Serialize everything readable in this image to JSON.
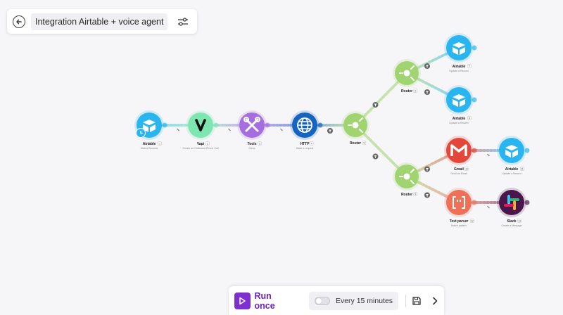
{
  "header": {
    "scenario_name": "Integration Airtable + voice agent"
  },
  "toolbar": {
    "run_once_label": "Run once",
    "schedule_label": "Every 15 minutes",
    "schedule_enabled": false
  },
  "colors": {
    "airtable": "#29b6f0",
    "vapi": "#7ee6b0",
    "tools": "#a56ee0",
    "http": "#1565c0",
    "router": "#9fd470",
    "gmail": "#e2473a",
    "text_parser": "#f07057",
    "slack": "#4a154b",
    "accent": "#7f2fd0"
  },
  "modules": [
    {
      "id": "m1",
      "name": "Airtable",
      "sub": "Watch Records",
      "kind": "airtable",
      "badge": "1"
    },
    {
      "id": "m2",
      "name": "Vapi",
      "sub": "Create an Outbound Phone Call",
      "kind": "vapi",
      "badge": "2"
    },
    {
      "id": "m3",
      "name": "Tools",
      "sub": "Sleep",
      "kind": "tools",
      "badge": "3"
    },
    {
      "id": "m4",
      "name": "HTTP",
      "sub": "Make a request",
      "kind": "http",
      "badge": "4"
    },
    {
      "id": "m5",
      "name": "Router",
      "sub": "",
      "kind": "router",
      "badge": "5"
    },
    {
      "id": "m6",
      "name": "Router",
      "sub": "",
      "kind": "router",
      "badge": "6"
    },
    {
      "id": "m7",
      "name": "Airtable",
      "sub": "Update a Record",
      "kind": "airtable",
      "badge": "7"
    },
    {
      "id": "m8",
      "name": "Airtable",
      "sub": "Update a Record",
      "kind": "airtable",
      "badge": "8"
    },
    {
      "id": "m9",
      "name": "Router",
      "sub": "",
      "kind": "router",
      "badge": "9"
    },
    {
      "id": "m10",
      "name": "Gmail",
      "sub": "Send an Email",
      "kind": "gmail",
      "badge": "10"
    },
    {
      "id": "m11",
      "name": "Airtable",
      "sub": "Update a Record",
      "kind": "airtable",
      "badge": "11"
    },
    {
      "id": "m12",
      "name": "Text parser",
      "sub": "Match pattern",
      "kind": "text_parser",
      "badge": "12"
    },
    {
      "id": "m13",
      "name": "Slack",
      "sub": "Create a Message",
      "kind": "slack",
      "badge": "13"
    }
  ]
}
